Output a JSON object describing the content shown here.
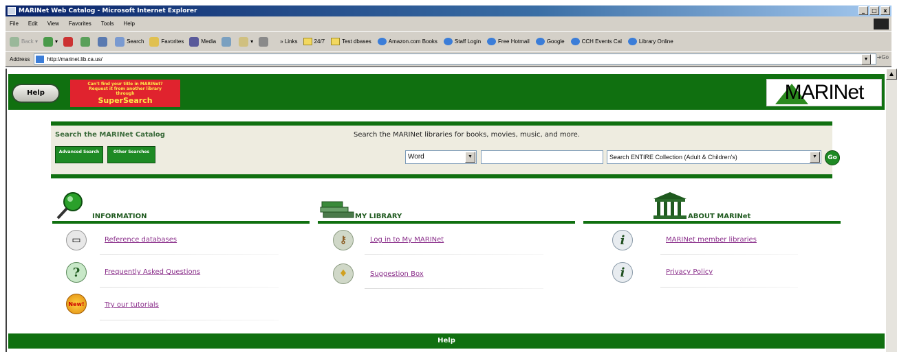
{
  "window": {
    "title": "MARINet Web Catalog - Microsoft Internet Explorer",
    "controls": [
      "_",
      "□",
      "x"
    ]
  },
  "menu": [
    "File",
    "Edit",
    "View",
    "Favorites",
    "Tools",
    "Help"
  ],
  "toolbar": {
    "back": "Back",
    "search": "Search",
    "favorites": "Favorites",
    "media": "Media",
    "links_label": "Links",
    "links": [
      "24/7",
      "Test dbases",
      "Amazon.com Books",
      "Staff Login",
      "Free Hotmail",
      "Google",
      "CCH Events Cal",
      "Library Online"
    ]
  },
  "address": {
    "label": "Address",
    "url": "http://marinet.lib.ca.us/",
    "go": "Go"
  },
  "banner": {
    "help": "Help",
    "supersearch_lines": [
      "Can't find your title in MARINet?",
      "Request it from another library",
      "through"
    ],
    "supersearch_big": "SuperSearch",
    "logo_text": "MARINet"
  },
  "search": {
    "title": "Search the MARINet Catalog",
    "advanced": "Advanced Search",
    "other": "Other Searches",
    "description": "Search the MARINet libraries for books, movies, music, and more.",
    "type_selected": "Word",
    "query_value": "",
    "scope_selected": "Search ENTIRE Collection (Adult & Children's)",
    "go": "Go"
  },
  "sections": {
    "information": {
      "heading": "INFORMATION",
      "items": [
        {
          "label": "Reference databases",
          "icon": "computer-icon"
        },
        {
          "label": "Frequently Asked Questions",
          "icon": "question-icon"
        },
        {
          "label": "Try our tutorials",
          "icon": "new-badge-icon",
          "badge": "New!"
        }
      ]
    },
    "my_library": {
      "heading": "MY LIBRARY",
      "items": [
        {
          "label": "Log in to My MARINet",
          "icon": "key-icon"
        },
        {
          "label": "Suggestion Box",
          "icon": "lightbulb-icon"
        }
      ]
    },
    "about": {
      "heading": "ABOUT MARINet",
      "items": [
        {
          "label": "MARINet member libraries",
          "icon": "info-icon"
        },
        {
          "label": "Privacy Policy",
          "icon": "info-icon"
        }
      ]
    }
  },
  "footer": {
    "help": "Help"
  },
  "colors": {
    "brand_green": "#107010",
    "link_purple": "#8a2e8a",
    "supersearch_red": "#e0232e"
  }
}
